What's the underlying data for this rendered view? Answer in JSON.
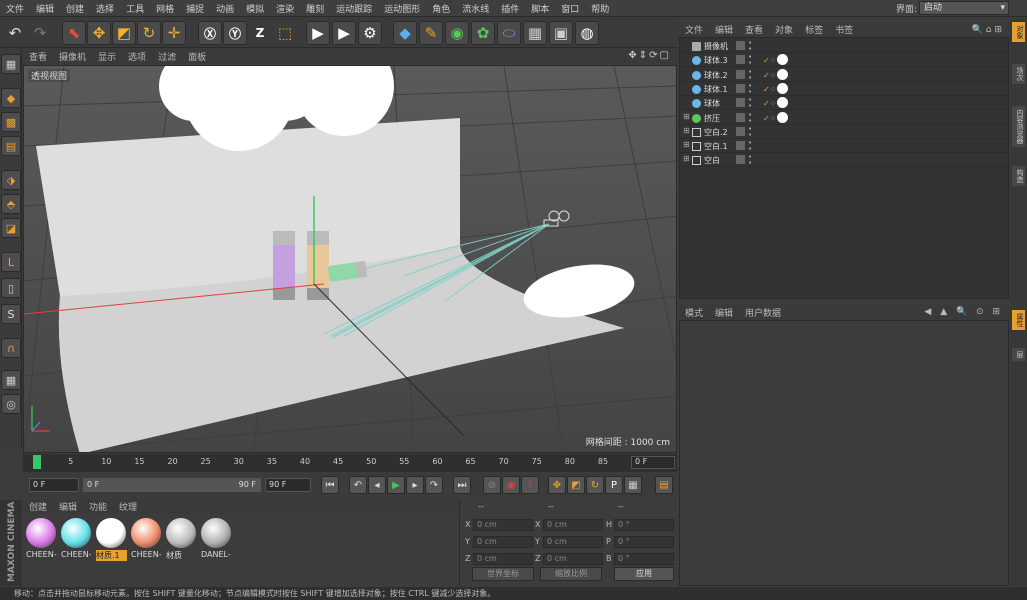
{
  "menubar": {
    "items": [
      "文件",
      "编辑",
      "创建",
      "选择",
      "工具",
      "网格",
      "捕捉",
      "动画",
      "模拟",
      "渲染",
      "雕刻",
      "运动跟踪",
      "运动图形",
      "角色",
      "流水线",
      "插件",
      "脚本",
      "窗口",
      "帮助"
    ],
    "layout_label": "界面:",
    "layout_value": "启动"
  },
  "viewport": {
    "menu": [
      "查看",
      "摄像机",
      "显示",
      "选项",
      "过滤",
      "面板"
    ],
    "name": "透视视图",
    "grid_info": "网格间距 : 1000 cm",
    "nav_icons": "✥⇕⟳▢"
  },
  "timeline": {
    "ticks": [
      "0",
      "5",
      "10",
      "15",
      "20",
      "25",
      "30",
      "35",
      "40",
      "45",
      "50",
      "55",
      "60",
      "65",
      "70",
      "75",
      "80",
      "85",
      "90"
    ],
    "frame_display": "0 F"
  },
  "transport": {
    "start": "0 F",
    "range_start": "0 F",
    "range_end": "90 F",
    "end": "90 F"
  },
  "materials": {
    "menu": [
      "创建",
      "编辑",
      "功能",
      "纹理"
    ],
    "items": [
      {
        "label": "CHEEN-",
        "color": "#d878e8"
      },
      {
        "label": "CHEEN-",
        "color": "#60e0e8"
      },
      {
        "label": "材质.1",
        "color": "#ffffff",
        "selected": true
      },
      {
        "label": "CHEEN-",
        "color": "#f08a68"
      },
      {
        "label": "材质",
        "color": "#bbbbbb"
      },
      {
        "label": "DANEL-",
        "color": "#b0b0b0"
      }
    ]
  },
  "coordinates": {
    "header": [
      "--",
      "--",
      "--"
    ],
    "rows": [
      {
        "a": "X",
        "av": "0 cm",
        "b": "X",
        "bv": "0 cm",
        "c": "H",
        "cv": "0 °"
      },
      {
        "a": "Y",
        "av": "0 cm",
        "b": "Y",
        "bv": "0 cm",
        "c": "P",
        "cv": "0 °"
      },
      {
        "a": "Z",
        "av": "0 cm",
        "b": "Z",
        "bv": "0 cm",
        "c": "B",
        "cv": "0 °"
      }
    ],
    "world_label": "世界坐标",
    "scale_label": "缩放比例",
    "apply_label": "应用"
  },
  "logo": "MAXON CINEMA 4D",
  "status": "移动：点击并拖动鼠标移动元素。按住 SHIFT 键量化移动；节点编辑模式时按住 SHIFT 键增加选择对象；按住 CTRL 键减少选择对象。",
  "object_manager": {
    "menu": [
      "文件",
      "编辑",
      "查看",
      "对象",
      "标签",
      "书签"
    ],
    "objects": [
      {
        "name": "摄像机",
        "icon": "camera",
        "color": "#aaaaaa",
        "tag": false
      },
      {
        "name": "球体.3",
        "icon": "sphere",
        "color": "#6ab8e8",
        "tag": true
      },
      {
        "name": "球体.2",
        "icon": "sphere",
        "color": "#6ab8e8",
        "tag": true
      },
      {
        "name": "球体.1",
        "icon": "sphere",
        "color": "#6ab8e8",
        "tag": true
      },
      {
        "name": "球体",
        "icon": "sphere",
        "color": "#6ab8e8",
        "tag": true
      },
      {
        "name": "挤压",
        "icon": "extrude",
        "color": "#5ac85a",
        "tag": true
      },
      {
        "name": "空白.2",
        "icon": "null",
        "color": "#cccccc",
        "tag": false
      },
      {
        "name": "空白.1",
        "icon": "null",
        "color": "#cccccc",
        "tag": false
      },
      {
        "name": "空白",
        "icon": "null",
        "color": "#cccccc",
        "tag": false
      }
    ]
  },
  "attributes": {
    "menu": [
      "模式",
      "编辑",
      "用户数据"
    ]
  },
  "right_tabs": [
    "对象",
    "场次",
    "内容浏览器",
    "构造",
    "属性",
    "层"
  ],
  "colors": {
    "accent": "#e8a030",
    "panel": "#3c3c3c",
    "viewport": "#585858"
  }
}
